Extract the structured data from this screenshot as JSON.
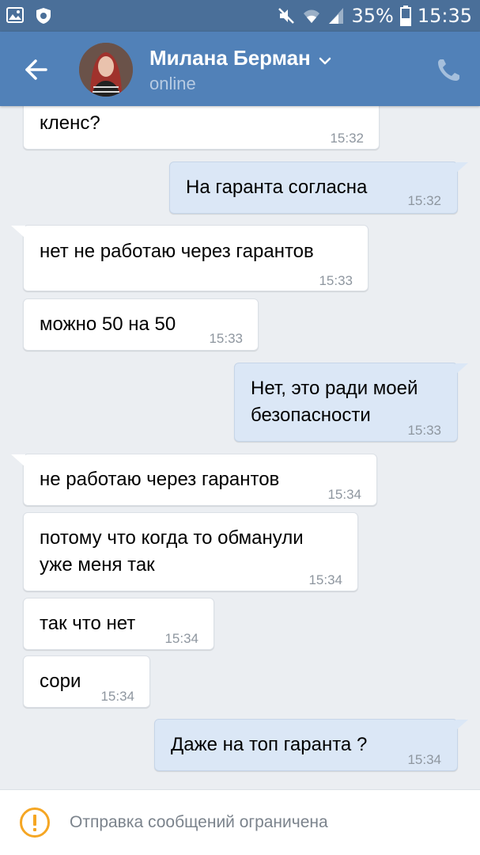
{
  "status_bar": {
    "battery_percent": "35%",
    "time": "15:35",
    "icons": [
      "gallery-icon",
      "shield-notification-icon",
      "mute-icon",
      "wifi-icon",
      "signal-icon",
      "battery-icon"
    ]
  },
  "header": {
    "contact_name": "Милана Берман",
    "status": "online",
    "icons": [
      "back-arrow-icon",
      "chevron-down-icon",
      "phone-icon"
    ]
  },
  "messages": [
    {
      "direction": "in",
      "text": "кленс?",
      "time": "15:32"
    },
    {
      "direction": "out",
      "text": "На гаранта согласна",
      "time": "15:32"
    },
    {
      "direction": "in",
      "text": "нет не работаю через гарантов",
      "time": "15:33"
    },
    {
      "direction": "in",
      "text": "можно 50 на 50",
      "time": "15:33"
    },
    {
      "direction": "out",
      "text": "Нет, это ради моей\nбезопасности",
      "time": "15:33"
    },
    {
      "direction": "in",
      "text": "не работаю через гарантов",
      "time": "15:34"
    },
    {
      "direction": "in",
      "text": "потому что когда то обманули\nуже меня так",
      "time": "15:34"
    },
    {
      "direction": "in",
      "text": "так что нет",
      "time": "15:34"
    },
    {
      "direction": "in",
      "text": "сори",
      "time": "15:34"
    },
    {
      "direction": "out",
      "text": "Даже на топ гаранта ?",
      "time": "15:34"
    }
  ],
  "bottom_bar": {
    "notice": "Отправка сообщений ограничена",
    "icon": "warning-icon"
  },
  "colors": {
    "status_bar": "#4a6f99",
    "header": "#5181b8",
    "background": "#ebeef2",
    "incoming_bubble": "#ffffff",
    "outgoing_bubble": "#dbe7f6",
    "warning": "#f5a623"
  }
}
